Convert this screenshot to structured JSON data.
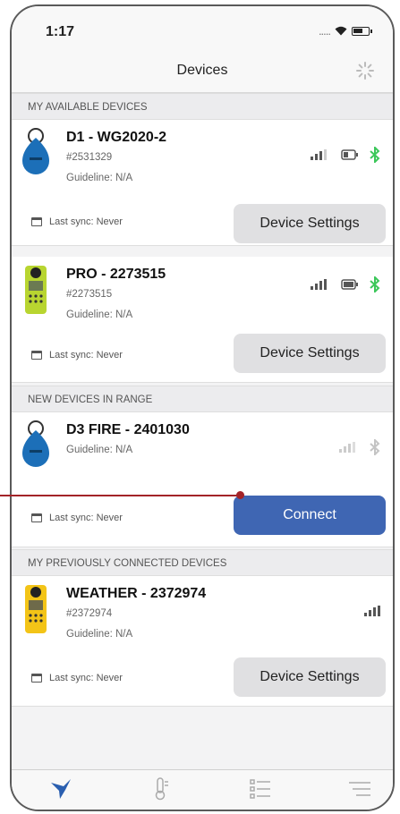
{
  "status_bar": {
    "time": "1:17",
    "signal_dots": "....."
  },
  "nav": {
    "title": "Devices"
  },
  "sections": {
    "available": "MY AVAILABLE DEVICES",
    "new_in_range": "NEW DEVICES IN RANGE",
    "previous": "MY PREVIOUSLY CONNECTED DEVICES"
  },
  "devices": [
    {
      "name": "D1 - WG2020-2",
      "serial": "#2531329",
      "guideline": "Guideline: N/A",
      "sync": "Last sync: Never",
      "button": "Device Settings",
      "icon": "blue-drop-device-icon",
      "bluetooth": "connected"
    },
    {
      "name": "PRO - 2273515",
      "serial": "#2273515",
      "guideline": "Guideline: N/A",
      "sync": "Last sync: Never",
      "button": "Device Settings",
      "icon": "green-weather-meter-icon",
      "bluetooth": "connected"
    },
    {
      "name": "D3 FIRE - 2401030",
      "guideline": "Guideline: N/A",
      "sync": "Last sync: Never",
      "button": "Connect",
      "icon": "blue-drop-device-icon",
      "bluetooth": "disconnected"
    },
    {
      "name": "WEATHER - 2372974",
      "serial": "#2372974",
      "guideline": "Guideline: N/A",
      "sync": "Last sync: Never",
      "button": "Device Settings",
      "icon": "yellow-weather-meter-icon"
    }
  ],
  "colors": {
    "accent": "#3f66b3",
    "bluetooth": "#3cc75a",
    "callout": "#a32328",
    "tab_active": "#2a5fb0"
  },
  "tabs": [
    "devices-tab",
    "measurements-tab",
    "list-tab",
    "menu-tab"
  ]
}
